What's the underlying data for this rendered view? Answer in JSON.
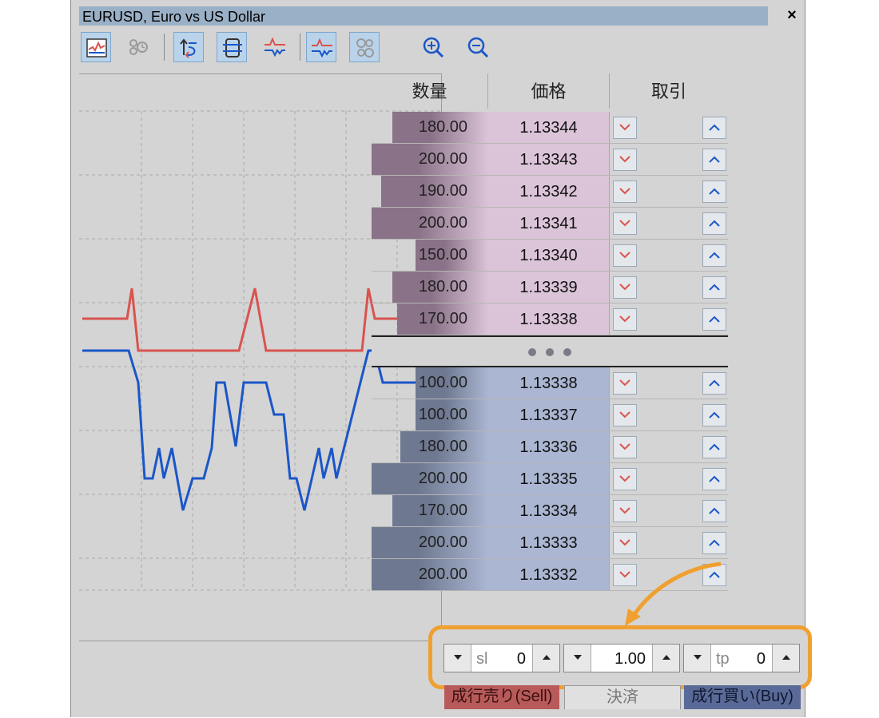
{
  "window": {
    "title": "EURUSD, Euro vs US Dollar",
    "close_label": "×"
  },
  "toolbar": {
    "buttons": [
      {
        "name": "chart-toggle-button",
        "icon": "chart-icon",
        "active": true
      },
      {
        "name": "timed-orders-button",
        "icon": "clock-gear-icon",
        "active": false
      },
      {
        "name": "auto-scroll-button",
        "icon": "scroll-arrow-icon",
        "active": true
      },
      {
        "name": "tick-filter-button",
        "icon": "box-lines-icon",
        "active": true
      },
      {
        "name": "bid-ask-lines-button",
        "icon": "price-lines-icon",
        "active": false
      },
      {
        "name": "level2-lines-button",
        "icon": "level-lines-icon",
        "active": true
      },
      {
        "name": "volume-bubbles-button",
        "icon": "bubbles-icon",
        "active": true
      },
      {
        "name": "zoom-in-button",
        "icon": "zoom-in-icon",
        "active": false
      },
      {
        "name": "zoom-out-button",
        "icon": "zoom-out-icon",
        "active": false
      }
    ]
  },
  "depth": {
    "headers": {
      "volume": "数量",
      "price": "価格",
      "trade": "取引"
    },
    "asks": [
      {
        "volume": "180.00",
        "vol_frac": 0.82,
        "price": "1.13344"
      },
      {
        "volume": "200.00",
        "vol_frac": 1.0,
        "price": "1.13343"
      },
      {
        "volume": "190.00",
        "vol_frac": 0.92,
        "price": "1.13342"
      },
      {
        "volume": "200.00",
        "vol_frac": 1.0,
        "price": "1.13341"
      },
      {
        "volume": "150.00",
        "vol_frac": 0.62,
        "price": "1.13340"
      },
      {
        "volume": "180.00",
        "vol_frac": 0.82,
        "price": "1.13339"
      },
      {
        "volume": "170.00",
        "vol_frac": 0.78,
        "price": "1.13338"
      }
    ],
    "bids": [
      {
        "volume": "100.00",
        "vol_frac": 0.62,
        "price": "1.13338"
      },
      {
        "volume": "100.00",
        "vol_frac": 0.62,
        "price": "1.13337"
      },
      {
        "volume": "180.00",
        "vol_frac": 0.75,
        "price": "1.13336"
      },
      {
        "volume": "200.00",
        "vol_frac": 1.0,
        "price": "1.13335"
      },
      {
        "volume": "170.00",
        "vol_frac": 0.82,
        "price": "1.13334"
      },
      {
        "volume": "200.00",
        "vol_frac": 1.0,
        "price": "1.13333"
      },
      {
        "volume": "200.00",
        "vol_frac": 1.0,
        "price": "1.13332"
      }
    ]
  },
  "order": {
    "sl": {
      "label": "sl",
      "value": "0"
    },
    "volume": {
      "value": "1.00"
    },
    "tp": {
      "label": "tp",
      "value": "0"
    }
  },
  "actions": {
    "sell_label": "成行売り(Sell)",
    "close_label": "決済",
    "buy_label": "成行買い(Buy)"
  },
  "colors": {
    "ask_bg": "#dcc4d8",
    "bid_bg": "#aab6d2",
    "ask_line": "#d9534f",
    "bid_line": "#1a56c8",
    "highlight": "#f0a030",
    "sell_btn": "#b85a5a",
    "buy_btn": "#5a6a98"
  }
}
